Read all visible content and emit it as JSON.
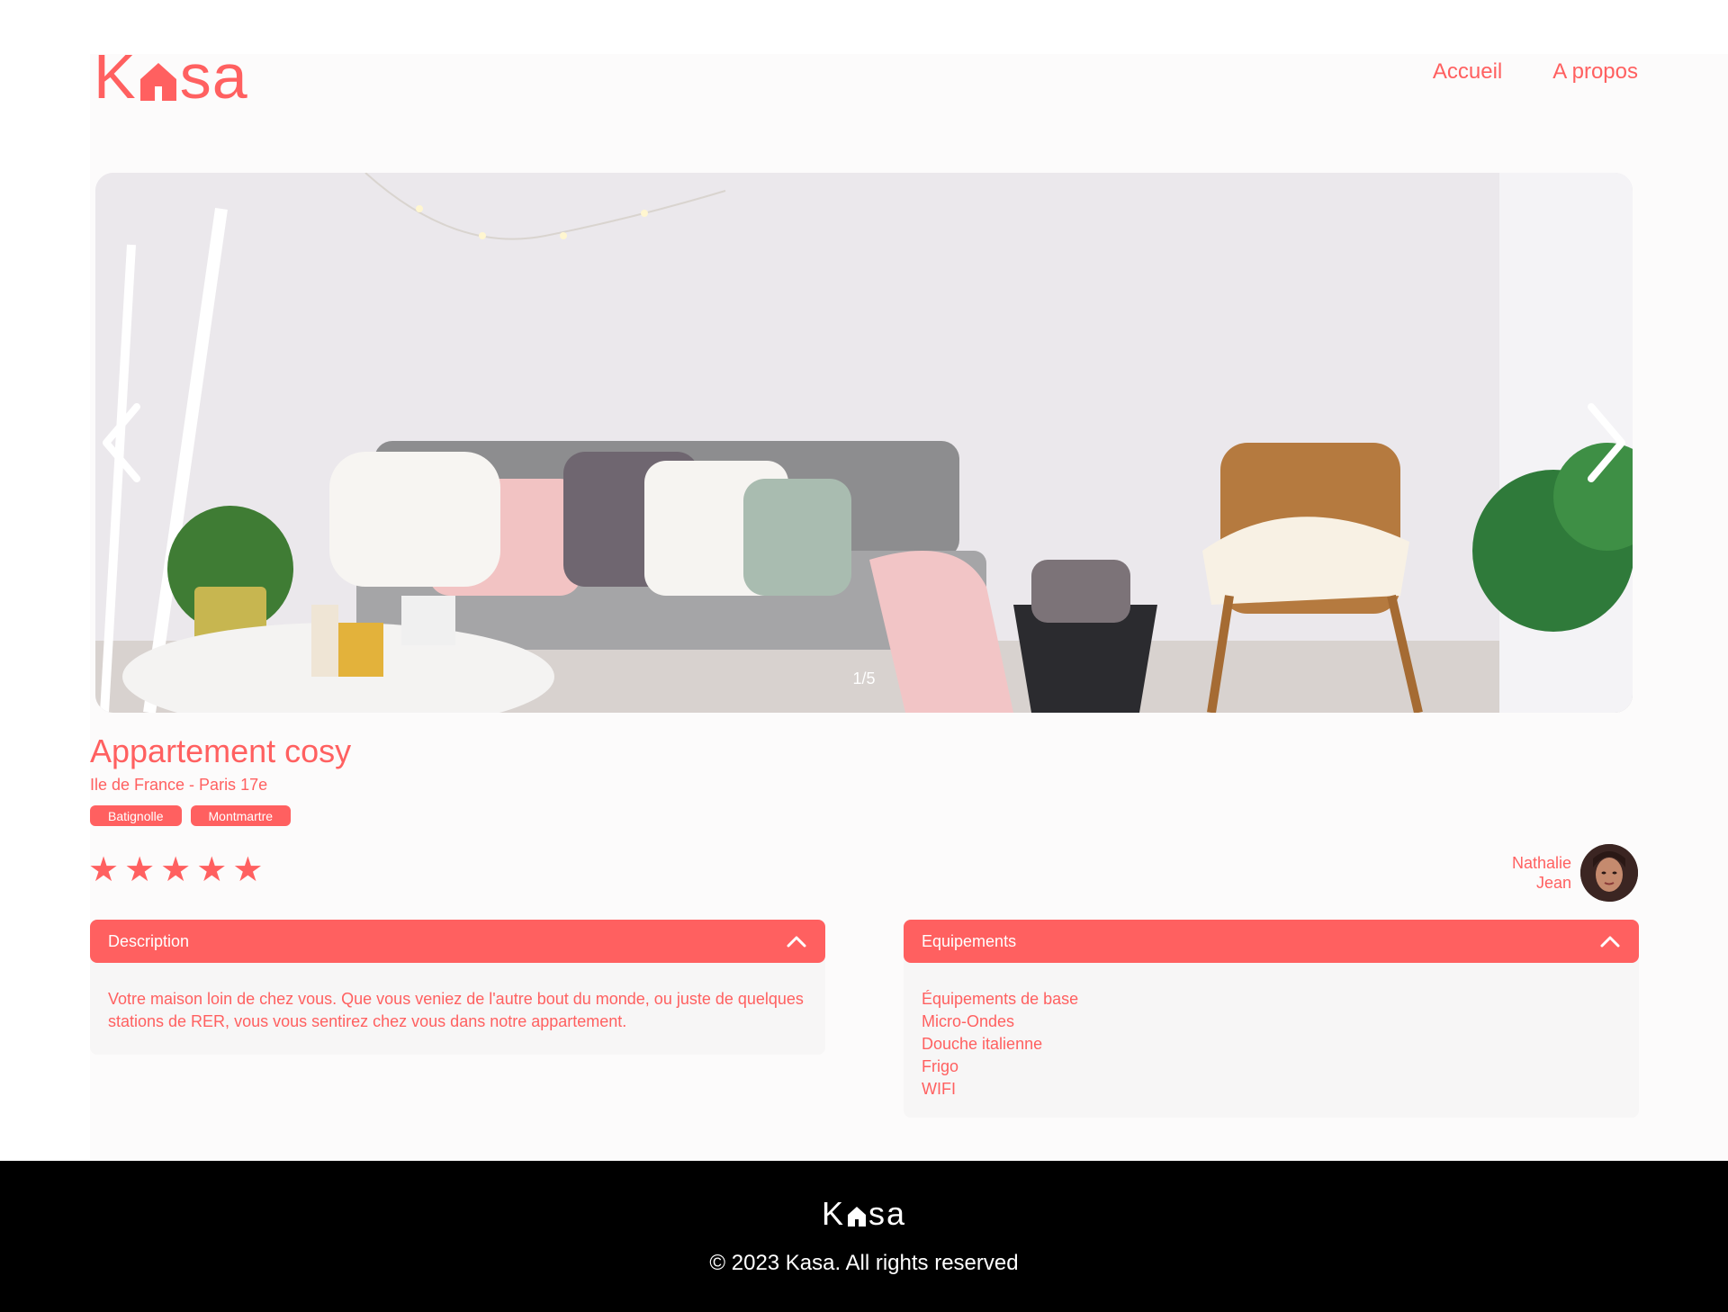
{
  "brand": {
    "name_prefix": "K",
    "name_suffix": "sa",
    "accent": "#ff6060"
  },
  "nav": {
    "home": "Accueil",
    "about": "A propos"
  },
  "carousel": {
    "counter": "1/5",
    "prev_icon": "chevron-left-icon",
    "next_icon": "chevron-right-icon"
  },
  "listing": {
    "title": "Appartement cosy",
    "location": "Ile de France - Paris 17e",
    "tags": [
      "Batignolle",
      "Montmartre"
    ],
    "rating": 5,
    "rating_max": 5,
    "host": {
      "first_name": "Nathalie",
      "last_name": "Jean"
    }
  },
  "description": {
    "label": "Description",
    "text": "Votre maison loin de chez vous. Que vous veniez de l'autre bout du monde, ou juste de quelques stations de RER, vous vous sentirez chez vous dans notre appartement."
  },
  "equipments": {
    "label": "Equipements",
    "items": [
      "Équipements de base",
      "Micro-Ondes",
      "Douche italienne",
      "Frigo",
      "WIFI"
    ]
  },
  "footer": {
    "copyright": "© 2023 Kasa. All rights reserved"
  }
}
